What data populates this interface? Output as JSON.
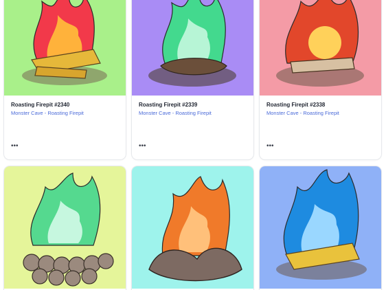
{
  "cards": [
    {
      "title": "Roasting Firepit #2340",
      "subtitle": "Monster Cave - Roasting Firepit",
      "more": "•••",
      "bg": "#a9f08a",
      "flame": "#f2394a",
      "flame_inner": "#ffb23b"
    },
    {
      "title": "Roasting Firepit #2339",
      "subtitle": "Monster Cave - Roasting Firepit",
      "more": "•••",
      "bg": "#a98cf5",
      "flame": "#43d98e",
      "flame_inner": "#b7f5d6"
    },
    {
      "title": "Roasting Firepit #2338",
      "subtitle": "Monster Cave - Roasting Firepit",
      "more": "•••",
      "bg": "#f49ba6",
      "flame": "#e2472b",
      "flame_inner": "#ffd15a"
    },
    {
      "bg": "#e5f59a",
      "flame": "#55d98f",
      "flame_inner": "#c6f7df"
    },
    {
      "bg": "#9ef3ec",
      "flame": "#f07a2a",
      "flame_inner": "#ffc07a"
    },
    {
      "bg": "#8fb1f7",
      "flame": "#1e8be0",
      "flame_inner": "#9ad7ff"
    }
  ]
}
